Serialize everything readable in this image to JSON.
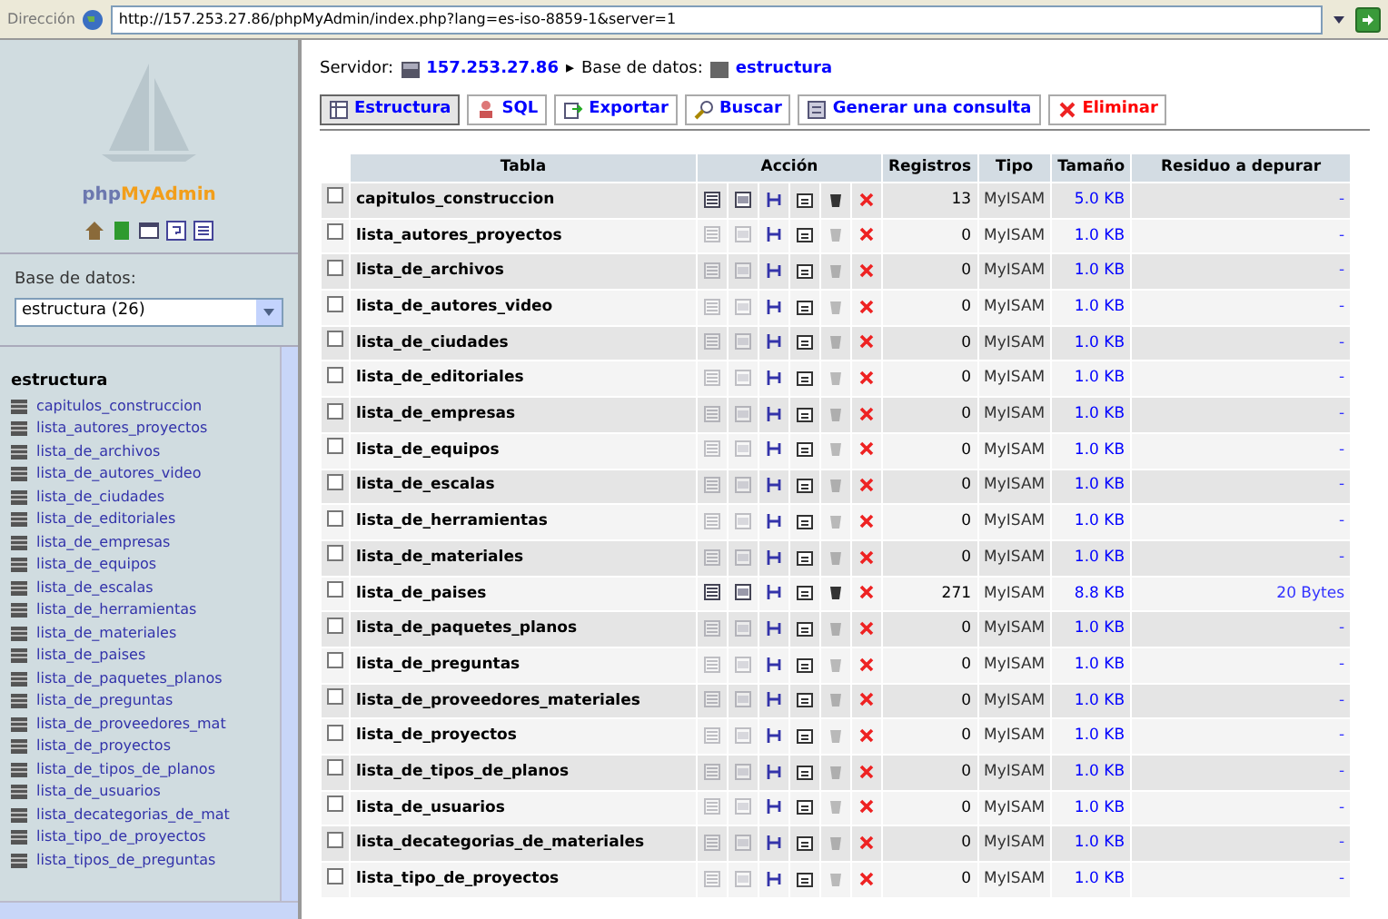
{
  "address_bar": {
    "label": "Dirección",
    "url": "http://157.253.27.86/phpMyAdmin/index.php?lang=es-iso-8859-1&server=1"
  },
  "sidebar": {
    "logo_php": "php",
    "logo_myadmin": "MyAdmin",
    "database_label": "Base de datos:",
    "database_value": "estructura (26)",
    "heading": "estructura",
    "tables": [
      "capitulos_construccion",
      "lista_autores_proyectos",
      "lista_de_archivos",
      "lista_de_autores_video",
      "lista_de_ciudades",
      "lista_de_editoriales",
      "lista_de_empresas",
      "lista_de_equipos",
      "lista_de_escalas",
      "lista_de_herramientas",
      "lista_de_materiales",
      "lista_de_paises",
      "lista_de_paquetes_planos",
      "lista_de_preguntas",
      "lista_de_proveedores_mat",
      "lista_de_proyectos",
      "lista_de_tipos_de_planos",
      "lista_de_usuarios",
      "lista_decategorias_de_mat",
      "lista_tipo_de_proyectos",
      "lista_tipos_de_preguntas"
    ]
  },
  "breadcrumb": {
    "server_label": "Servidor:",
    "server": "157.253.27.86",
    "separator": "▸",
    "db_label": "Base de datos:",
    "db": "estructura"
  },
  "tabs": [
    {
      "label": "Estructura",
      "kind": "structure",
      "selected": true
    },
    {
      "label": "SQL",
      "kind": "sql",
      "selected": false
    },
    {
      "label": "Exportar",
      "kind": "export",
      "selected": false
    },
    {
      "label": "Buscar",
      "kind": "search",
      "selected": false
    },
    {
      "label": "Generar una consulta",
      "kind": "query",
      "selected": false
    },
    {
      "label": "Eliminar",
      "kind": "drop",
      "selected": false
    }
  ],
  "table": {
    "columns": [
      "Tabla",
      "Acción",
      "Registros",
      "Tipo",
      "Tamaño",
      "Residuo a depurar"
    ],
    "rows": [
      {
        "name": "capitulos_construccion",
        "checked": false,
        "has_data": true,
        "records": "13",
        "type": "MyISAM",
        "size": "5.0 KB",
        "overhead": "-"
      },
      {
        "name": "lista_autores_proyectos",
        "checked": false,
        "has_data": false,
        "records": "0",
        "type": "MyISAM",
        "size": "1.0 KB",
        "overhead": "-"
      },
      {
        "name": "lista_de_archivos",
        "checked": false,
        "has_data": false,
        "records": "0",
        "type": "MyISAM",
        "size": "1.0 KB",
        "overhead": "-"
      },
      {
        "name": "lista_de_autores_video",
        "checked": false,
        "has_data": false,
        "records": "0",
        "type": "MyISAM",
        "size": "1.0 KB",
        "overhead": "-"
      },
      {
        "name": "lista_de_ciudades",
        "checked": false,
        "has_data": false,
        "records": "0",
        "type": "MyISAM",
        "size": "1.0 KB",
        "overhead": "-"
      },
      {
        "name": "lista_de_editoriales",
        "checked": false,
        "has_data": false,
        "records": "0",
        "type": "MyISAM",
        "size": "1.0 KB",
        "overhead": "-"
      },
      {
        "name": "lista_de_empresas",
        "checked": false,
        "has_data": false,
        "records": "0",
        "type": "MyISAM",
        "size": "1.0 KB",
        "overhead": "-"
      },
      {
        "name": "lista_de_equipos",
        "checked": false,
        "has_data": false,
        "records": "0",
        "type": "MyISAM",
        "size": "1.0 KB",
        "overhead": "-"
      },
      {
        "name": "lista_de_escalas",
        "checked": false,
        "has_data": false,
        "records": "0",
        "type": "MyISAM",
        "size": "1.0 KB",
        "overhead": "-"
      },
      {
        "name": "lista_de_herramientas",
        "checked": false,
        "has_data": false,
        "records": "0",
        "type": "MyISAM",
        "size": "1.0 KB",
        "overhead": "-"
      },
      {
        "name": "lista_de_materiales",
        "checked": false,
        "has_data": false,
        "records": "0",
        "type": "MyISAM",
        "size": "1.0 KB",
        "overhead": "-"
      },
      {
        "name": "lista_de_paises",
        "checked": false,
        "has_data": true,
        "records": "271",
        "type": "MyISAM",
        "size": "8.8 KB",
        "overhead": "20 Bytes"
      },
      {
        "name": "lista_de_paquetes_planos",
        "checked": false,
        "has_data": false,
        "records": "0",
        "type": "MyISAM",
        "size": "1.0 KB",
        "overhead": "-"
      },
      {
        "name": "lista_de_preguntas",
        "checked": false,
        "has_data": false,
        "records": "0",
        "type": "MyISAM",
        "size": "1.0 KB",
        "overhead": "-"
      },
      {
        "name": "lista_de_proveedores_materiales",
        "checked": false,
        "has_data": false,
        "records": "0",
        "type": "MyISAM",
        "size": "1.0 KB",
        "overhead": "-"
      },
      {
        "name": "lista_de_proyectos",
        "checked": false,
        "has_data": false,
        "records": "0",
        "type": "MyISAM",
        "size": "1.0 KB",
        "overhead": "-"
      },
      {
        "name": "lista_de_tipos_de_planos",
        "checked": false,
        "has_data": false,
        "records": "0",
        "type": "MyISAM",
        "size": "1.0 KB",
        "overhead": "-"
      },
      {
        "name": "lista_de_usuarios",
        "checked": false,
        "has_data": false,
        "records": "0",
        "type": "MyISAM",
        "size": "1.0 KB",
        "overhead": "-"
      },
      {
        "name": "lista_decategorias_de_materiales",
        "checked": false,
        "has_data": false,
        "records": "0",
        "type": "MyISAM",
        "size": "1.0 KB",
        "overhead": "-"
      },
      {
        "name": "lista_tipo_de_proyectos",
        "checked": false,
        "has_data": false,
        "records": "0",
        "type": "MyISAM",
        "size": "1.0 KB",
        "overhead": "-"
      }
    ]
  }
}
